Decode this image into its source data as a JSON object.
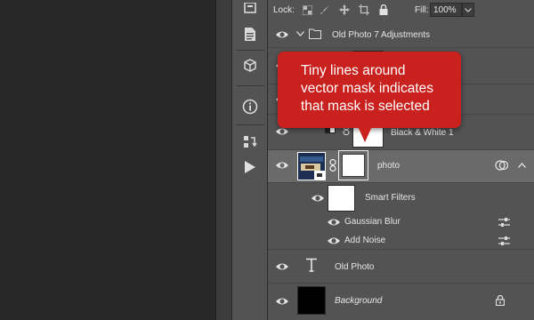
{
  "lock_bar": {
    "lock_label": "Lock:",
    "fill_label": "Fill:",
    "fill_value": "100%"
  },
  "callout": {
    "lines": [
      "Tiny lines around",
      "vector mask indicates",
      "that mask is selected"
    ],
    "color": "#c8211e"
  },
  "layers": {
    "group_name": "Old Photo 7 Adjustments",
    "black_white": "Black & White 1",
    "photo": "photo",
    "smart_filters": "Smart Filters",
    "filters": [
      "Gaussian Blur",
      "Add Noise"
    ],
    "old_photo": "Old Photo",
    "background": "Background"
  },
  "tools": [
    "history-icon",
    "document-icon",
    "3d-cube-icon",
    "info-icon",
    "swap-icon",
    "play-icon"
  ]
}
